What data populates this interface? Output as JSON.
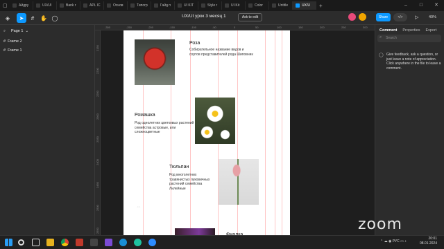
{
  "tabs": [
    {
      "label": "Айдру"
    },
    {
      "label": "UX/UI"
    },
    {
      "label": "Bank r"
    },
    {
      "label": "APL IC"
    },
    {
      "label": "Основ"
    },
    {
      "label": "Типогр"
    },
    {
      "label": "Гайд п"
    },
    {
      "label": "UI KIT"
    },
    {
      "label": "Style r"
    },
    {
      "label": "UI Kit"
    },
    {
      "label": "Color"
    },
    {
      "label": "Untitle"
    },
    {
      "label": "UX/U"
    }
  ],
  "window": {
    "minimize": "–",
    "maximize": "□",
    "close": "✕"
  },
  "toolbar": {
    "file_title": "UX/UI урок 3 месяц 1",
    "ask_label": "Ask to edit",
    "share_label": "Share",
    "code_label": "</>",
    "zoom": "40%"
  },
  "left_panel": {
    "page": "Page 1",
    "layers": [
      "Frame 2",
      "Frame 1"
    ]
  },
  "ruler": {
    "top": [
      "-300",
      "-250",
      "-200",
      "-150",
      "-100",
      "-50",
      "0",
      "50",
      "100",
      "150",
      "200",
      "250",
      "300"
    ],
    "left": [
      "2150",
      "2200",
      "2250",
      "2300",
      "2350",
      "2400",
      "2450",
      "2500",
      "2550"
    ]
  },
  "frame": {
    "items": [
      {
        "title": "Роза",
        "desc": "Собирательное название видов и сортов представителей рода Шиповник"
      },
      {
        "title": "Ромашка",
        "desc": "Род однолетних цветковых растений семейства астровые, или сложноцветные"
      },
      {
        "title": "Тюльпан",
        "desc": "Род многолетних травянистых луковичных растений семейства Лилейные"
      },
      {
        "title": "Фиалка",
        "desc": ""
      }
    ]
  },
  "right_panel": {
    "tabs": [
      "Comment",
      "Properties",
      "Export"
    ],
    "search_placeholder": "Search",
    "comment_hint": "Give feedback, ask a question, or just leave a note of appreciation. Click anywhere in the file to leave a comment."
  },
  "zoom_logo": "zoom",
  "taskbar": {
    "time": "20:01",
    "date": "08.01.2024",
    "lang": "РУС"
  },
  "colors": {
    "accent": "#0d99ff",
    "canvas": "#1e1e1e",
    "panel": "#2c2c2c"
  }
}
